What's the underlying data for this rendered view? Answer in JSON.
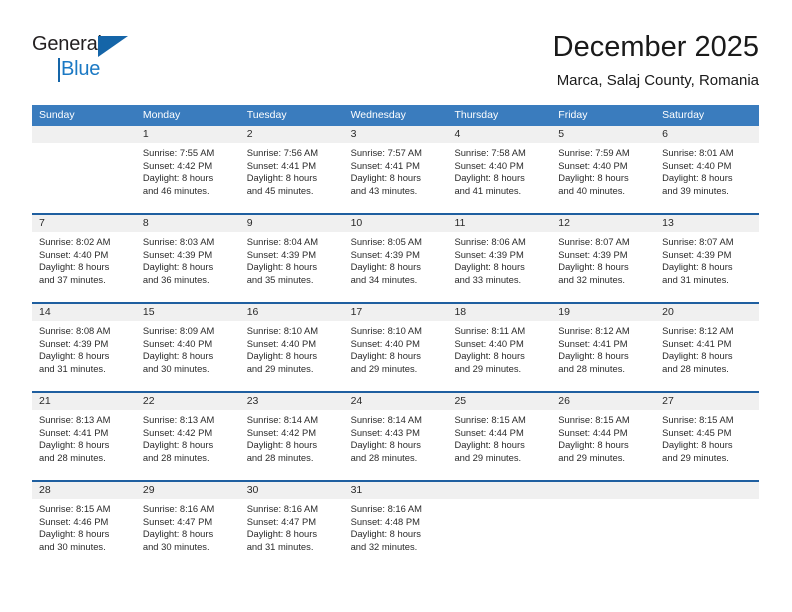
{
  "logo": {
    "word1": "General",
    "word2": "Blue",
    "triangle_color": "#1565a8",
    "blue_color": "#1b79c4"
  },
  "header": {
    "title": "December 2025",
    "subtitle": "Marca, Salaj County, Romania"
  },
  "colors": {
    "header_blue": "#3a7cbe",
    "separator_blue": "#1f5fa0",
    "daynum_band": "#f0f0f0",
    "text": "#2b2b2b"
  },
  "weekdays": [
    "Sunday",
    "Monday",
    "Tuesday",
    "Wednesday",
    "Thursday",
    "Friday",
    "Saturday"
  ],
  "weeks": [
    [
      {
        "day": ""
      },
      {
        "day": "1",
        "sunrise": "Sunrise: 7:55 AM",
        "sunset": "Sunset: 4:42 PM",
        "daylight1": "Daylight: 8 hours",
        "daylight2": "and 46 minutes."
      },
      {
        "day": "2",
        "sunrise": "Sunrise: 7:56 AM",
        "sunset": "Sunset: 4:41 PM",
        "daylight1": "Daylight: 8 hours",
        "daylight2": "and 45 minutes."
      },
      {
        "day": "3",
        "sunrise": "Sunrise: 7:57 AM",
        "sunset": "Sunset: 4:41 PM",
        "daylight1": "Daylight: 8 hours",
        "daylight2": "and 43 minutes."
      },
      {
        "day": "4",
        "sunrise": "Sunrise: 7:58 AM",
        "sunset": "Sunset: 4:40 PM",
        "daylight1": "Daylight: 8 hours",
        "daylight2": "and 41 minutes."
      },
      {
        "day": "5",
        "sunrise": "Sunrise: 7:59 AM",
        "sunset": "Sunset: 4:40 PM",
        "daylight1": "Daylight: 8 hours",
        "daylight2": "and 40 minutes."
      },
      {
        "day": "6",
        "sunrise": "Sunrise: 8:01 AM",
        "sunset": "Sunset: 4:40 PM",
        "daylight1": "Daylight: 8 hours",
        "daylight2": "and 39 minutes."
      }
    ],
    [
      {
        "day": "7",
        "sunrise": "Sunrise: 8:02 AM",
        "sunset": "Sunset: 4:40 PM",
        "daylight1": "Daylight: 8 hours",
        "daylight2": "and 37 minutes."
      },
      {
        "day": "8",
        "sunrise": "Sunrise: 8:03 AM",
        "sunset": "Sunset: 4:39 PM",
        "daylight1": "Daylight: 8 hours",
        "daylight2": "and 36 minutes."
      },
      {
        "day": "9",
        "sunrise": "Sunrise: 8:04 AM",
        "sunset": "Sunset: 4:39 PM",
        "daylight1": "Daylight: 8 hours",
        "daylight2": "and 35 minutes."
      },
      {
        "day": "10",
        "sunrise": "Sunrise: 8:05 AM",
        "sunset": "Sunset: 4:39 PM",
        "daylight1": "Daylight: 8 hours",
        "daylight2": "and 34 minutes."
      },
      {
        "day": "11",
        "sunrise": "Sunrise: 8:06 AM",
        "sunset": "Sunset: 4:39 PM",
        "daylight1": "Daylight: 8 hours",
        "daylight2": "and 33 minutes."
      },
      {
        "day": "12",
        "sunrise": "Sunrise: 8:07 AM",
        "sunset": "Sunset: 4:39 PM",
        "daylight1": "Daylight: 8 hours",
        "daylight2": "and 32 minutes."
      },
      {
        "day": "13",
        "sunrise": "Sunrise: 8:07 AM",
        "sunset": "Sunset: 4:39 PM",
        "daylight1": "Daylight: 8 hours",
        "daylight2": "and 31 minutes."
      }
    ],
    [
      {
        "day": "14",
        "sunrise": "Sunrise: 8:08 AM",
        "sunset": "Sunset: 4:39 PM",
        "daylight1": "Daylight: 8 hours",
        "daylight2": "and 31 minutes."
      },
      {
        "day": "15",
        "sunrise": "Sunrise: 8:09 AM",
        "sunset": "Sunset: 4:40 PM",
        "daylight1": "Daylight: 8 hours",
        "daylight2": "and 30 minutes."
      },
      {
        "day": "16",
        "sunrise": "Sunrise: 8:10 AM",
        "sunset": "Sunset: 4:40 PM",
        "daylight1": "Daylight: 8 hours",
        "daylight2": "and 29 minutes."
      },
      {
        "day": "17",
        "sunrise": "Sunrise: 8:10 AM",
        "sunset": "Sunset: 4:40 PM",
        "daylight1": "Daylight: 8 hours",
        "daylight2": "and 29 minutes."
      },
      {
        "day": "18",
        "sunrise": "Sunrise: 8:11 AM",
        "sunset": "Sunset: 4:40 PM",
        "daylight1": "Daylight: 8 hours",
        "daylight2": "and 29 minutes."
      },
      {
        "day": "19",
        "sunrise": "Sunrise: 8:12 AM",
        "sunset": "Sunset: 4:41 PM",
        "daylight1": "Daylight: 8 hours",
        "daylight2": "and 28 minutes."
      },
      {
        "day": "20",
        "sunrise": "Sunrise: 8:12 AM",
        "sunset": "Sunset: 4:41 PM",
        "daylight1": "Daylight: 8 hours",
        "daylight2": "and 28 minutes."
      }
    ],
    [
      {
        "day": "21",
        "sunrise": "Sunrise: 8:13 AM",
        "sunset": "Sunset: 4:41 PM",
        "daylight1": "Daylight: 8 hours",
        "daylight2": "and 28 minutes."
      },
      {
        "day": "22",
        "sunrise": "Sunrise: 8:13 AM",
        "sunset": "Sunset: 4:42 PM",
        "daylight1": "Daylight: 8 hours",
        "daylight2": "and 28 minutes."
      },
      {
        "day": "23",
        "sunrise": "Sunrise: 8:14 AM",
        "sunset": "Sunset: 4:42 PM",
        "daylight1": "Daylight: 8 hours",
        "daylight2": "and 28 minutes."
      },
      {
        "day": "24",
        "sunrise": "Sunrise: 8:14 AM",
        "sunset": "Sunset: 4:43 PM",
        "daylight1": "Daylight: 8 hours",
        "daylight2": "and 28 minutes."
      },
      {
        "day": "25",
        "sunrise": "Sunrise: 8:15 AM",
        "sunset": "Sunset: 4:44 PM",
        "daylight1": "Daylight: 8 hours",
        "daylight2": "and 29 minutes."
      },
      {
        "day": "26",
        "sunrise": "Sunrise: 8:15 AM",
        "sunset": "Sunset: 4:44 PM",
        "daylight1": "Daylight: 8 hours",
        "daylight2": "and 29 minutes."
      },
      {
        "day": "27",
        "sunrise": "Sunrise: 8:15 AM",
        "sunset": "Sunset: 4:45 PM",
        "daylight1": "Daylight: 8 hours",
        "daylight2": "and 29 minutes."
      }
    ],
    [
      {
        "day": "28",
        "sunrise": "Sunrise: 8:15 AM",
        "sunset": "Sunset: 4:46 PM",
        "daylight1": "Daylight: 8 hours",
        "daylight2": "and 30 minutes."
      },
      {
        "day": "29",
        "sunrise": "Sunrise: 8:16 AM",
        "sunset": "Sunset: 4:47 PM",
        "daylight1": "Daylight: 8 hours",
        "daylight2": "and 30 minutes."
      },
      {
        "day": "30",
        "sunrise": "Sunrise: 8:16 AM",
        "sunset": "Sunset: 4:47 PM",
        "daylight1": "Daylight: 8 hours",
        "daylight2": "and 31 minutes."
      },
      {
        "day": "31",
        "sunrise": "Sunrise: 8:16 AM",
        "sunset": "Sunset: 4:48 PM",
        "daylight1": "Daylight: 8 hours",
        "daylight2": "and 32 minutes."
      },
      {
        "day": ""
      },
      {
        "day": ""
      },
      {
        "day": ""
      }
    ]
  ]
}
